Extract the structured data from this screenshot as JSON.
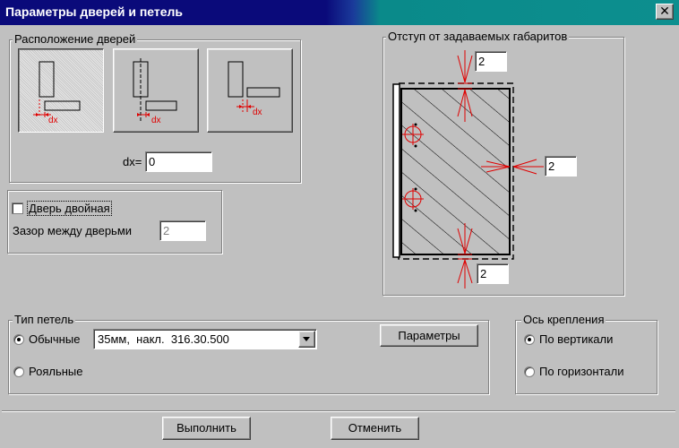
{
  "window": {
    "title": "Параметры дверей и петель",
    "close_label": "✕"
  },
  "door_layout": {
    "legend": "Расположение дверей",
    "option_labels": [
      "dx",
      "dx",
      "dx"
    ],
    "dx_label": "dx=",
    "dx_value": "0"
  },
  "double_door": {
    "checkbox_label": "Дверь двойная",
    "checked": false,
    "gap_label": "Зазор между дверьми",
    "gap_value": "2"
  },
  "offset": {
    "legend": "Отступ от задаваемых габаритов",
    "top_value": "2",
    "right_value": "2",
    "bottom_value": "2"
  },
  "hinge_type": {
    "legend": "Тип петель",
    "option_normal": "Обычные",
    "option_piano": "Рояльные",
    "selected": "Обычные",
    "select_value": "35мм,  накл.  316.30.500",
    "params_button": "Параметры"
  },
  "axis": {
    "legend": "Ось крепления",
    "option_vertical": "По вертикали",
    "option_horizontal": "По горизонтали",
    "selected": "По вертикали"
  },
  "footer": {
    "ok_button": "Выполнить",
    "cancel_button": "Отменить"
  },
  "colors": {
    "title_bar": "#0a0a7a",
    "title_bar_end": "#0d8f8f",
    "accent_red": "#e00000",
    "face": "#c0c0c0"
  }
}
